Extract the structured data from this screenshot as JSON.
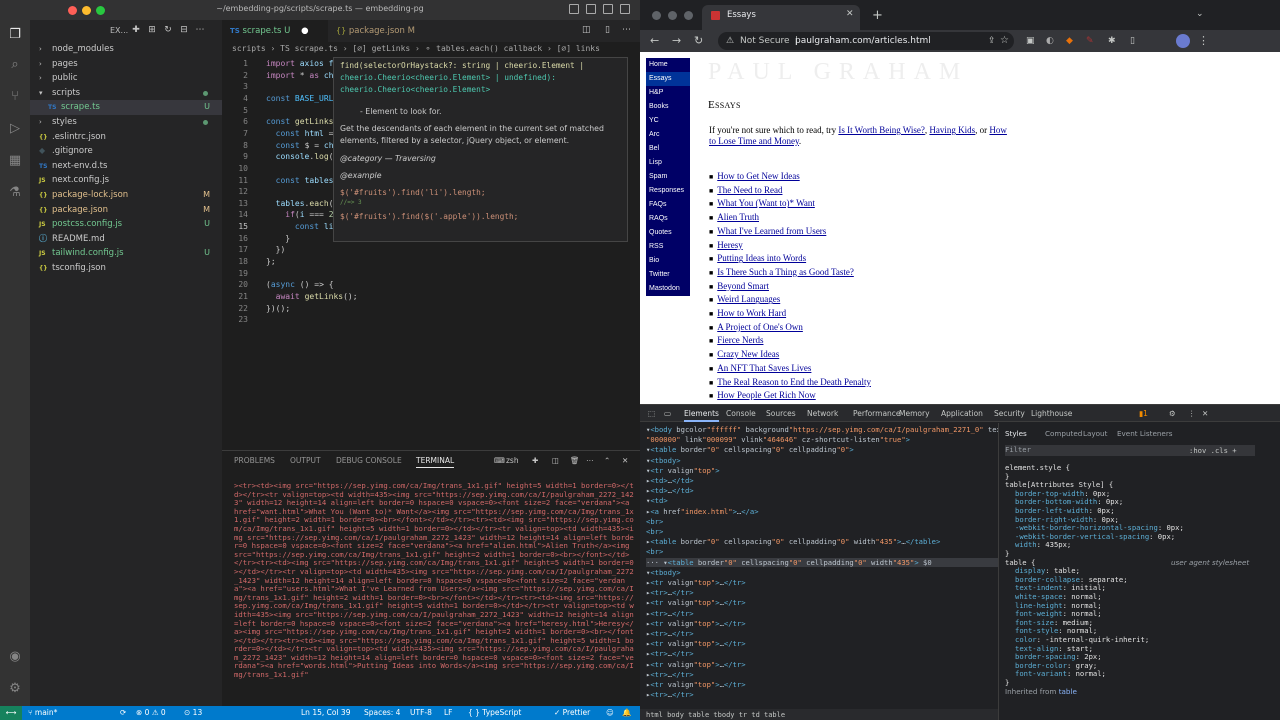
{
  "vscode": {
    "window_title": "~/embedding-pg/scripts/scrape.ts — embedding-pg",
    "explorer_label": "EX...",
    "tree": [
      {
        "name": "node_modules",
        "kind": "folder",
        "open": false,
        "indent": 1,
        "color": "#cccccc"
      },
      {
        "name": "pages",
        "kind": "folder",
        "open": false,
        "indent": 1,
        "color": "#cccccc"
      },
      {
        "name": "public",
        "kind": "folder",
        "open": false,
        "indent": 1,
        "color": "#cccccc"
      },
      {
        "name": "scripts",
        "kind": "folder",
        "open": true,
        "indent": 1,
        "color": "#cccccc"
      },
      {
        "name": "scrape.ts",
        "kind": "ts",
        "indent": 2,
        "color": "#73c991",
        "badge": "U",
        "selected": true
      },
      {
        "name": "styles",
        "kind": "folder",
        "open": false,
        "indent": 1,
        "color": "#cccccc"
      },
      {
        "name": ".eslintrc.json",
        "kind": "json",
        "indent": 1,
        "color": "#cccccc"
      },
      {
        "name": ".gitignore",
        "kind": "git",
        "indent": 1,
        "color": "#cccccc"
      },
      {
        "name": "next-env.d.ts",
        "kind": "ts",
        "indent": 1,
        "color": "#cccccc"
      },
      {
        "name": "next.config.js",
        "kind": "js",
        "indent": 1,
        "color": "#cccccc"
      },
      {
        "name": "package-lock.json",
        "kind": "json",
        "indent": 1,
        "color": "#e2c08d",
        "badge": "M"
      },
      {
        "name": "package.json",
        "kind": "json",
        "indent": 1,
        "color": "#e2c08d",
        "badge": "M"
      },
      {
        "name": "postcss.config.js",
        "kind": "js",
        "indent": 1,
        "color": "#73c991",
        "badge": "U"
      },
      {
        "name": "README.md",
        "kind": "md",
        "indent": 1,
        "color": "#cccccc"
      },
      {
        "name": "tailwind.config.js",
        "kind": "js",
        "indent": 1,
        "color": "#73c991",
        "badge": "U"
      },
      {
        "name": "tsconfig.json",
        "kind": "json",
        "indent": 1,
        "color": "#cccccc"
      }
    ],
    "tabs": [
      {
        "label": "scrape.ts",
        "badge": "U",
        "active": true
      },
      {
        "label": "package.json",
        "badge": "M",
        "active": false
      }
    ],
    "breadcrumbs": "scripts  ›  TS scrape.ts  ›  [∅] getLinks  ›  ⚬ tables.each() callback  ›  [∅] links",
    "line_numbers": [
      "1",
      "2",
      "3",
      "4",
      "5",
      "6",
      "7",
      "8",
      "9",
      "10",
      "11",
      "12",
      "13",
      "14",
      "15",
      "16",
      "17",
      "18",
      "19",
      "20",
      "21",
      "22",
      "23"
    ],
    "current_line": "15",
    "code": [
      "import axios fr",
      "import * as che",
      "",
      "const BASE_URL",
      "",
      "const getLinks",
      "  const html = ",
      "  const $ = che",
      "  console.log(h",
      "",
      "  const tables ",
      "",
      "  tables.each((",
      "    if(i === 2){",
      "      const links = $(tables).find(\"\");",
      "    }",
      "  })",
      "};",
      "",
      "(async () => {",
      "  await getLinks();",
      "})();",
      ""
    ],
    "hover": {
      "sig1": "find(selectorOrHaystack?: string | cheerio.Element |",
      "sig2": "cheerio.Cheerio<cheerio.Element> | undefined):",
      "sig3": "cheerio.Cheerio<cheerio.Element>",
      "param": "- Element to look for.",
      "desc1": "Get the descendants of each element in the current set of matched",
      "desc2": "elements, filtered by a selector, jQuery object, or element.",
      "category": "@category — Traversing",
      "example_tag": "@example",
      "ex1": "$('#fruits').find('li').length;",
      "ex1c": "//=> 3",
      "ex2": "$('#fruits').find($('.apple')).length;"
    },
    "panel_tabs": [
      "PROBLEMS",
      "OUTPUT",
      "DEBUG CONSOLE",
      "TERMINAL"
    ],
    "terminal_shell": "zsh",
    "terminal_text": "><tr><td><img src=\"https://sep.yimg.com/ca/Img/trans_1x1.gif\" height=5 width=1 border=0></td></tr><tr valign=top><td width=435><img src=\"https://sep.yimg.com/ca/I/paulgraham_2272_1423\" width=12 height=14 align=left border=0 hspace=0 vspace=0><font size=2 face=\"verdana\"><a href=\"want.html\">What You (Want to)* Want</a><img src=\"https://sep.yimg.com/ca/Img/trans_1x1.gif\" height=2 width=1 border=0><br></font></td></tr><tr><td><img src=\"https://sep.yimg.com/ca/Img/trans_1x1.gif\" height=5 width=1 border=0></td></tr><tr valign=top><td width=435><img src=\"https://sep.yimg.com/ca/I/paulgraham_2272_1423\" width=12 height=14 align=left border=0 hspace=0 vspace=0><font size=2 face=\"verdana\"><a href=\"alien.html\">Alien Truth</a><img src=\"https://sep.yimg.com/ca/Img/trans_1x1.gif\" height=2 width=1 border=0><br></font></td></tr><tr><td><img src=\"https://sep.yimg.com/ca/Img/trans_1x1.gif\" height=5 width=1 border=0></td></tr><tr valign=top><td width=435><img src=\"https://sep.yimg.com/ca/I/paulgraham_2272_1423\" width=12 height=14 align=left border=0 hspace=0 vspace=0><font size=2 face=\"verdana\"><a href=\"users.html\">What I've Learned from Users</a><img src=\"https://sep.yimg.com/ca/Img/trans_1x1.gif\" height=2 width=1 border=0><br></font></td></tr><tr><td><img src=\"https://sep.yimg.com/ca/Img/trans_1x1.gif\" height=5 width=1 border=0></td></tr><tr valign=top><td width=435><img src=\"https://sep.yimg.com/ca/I/paulgraham_2272_1423\" width=12 height=14 align=left border=0 hspace=0 vspace=0><font size=2 face=\"verdana\"><a href=\"heresy.html\">Heresy</a><img src=\"https://sep.yimg.com/ca/Img/trans_1x1.gif\" height=2 width=1 border=0><br></font></td></tr><tr><td><img src=\"https://sep.yimg.com/ca/Img/trans_1x1.gif\" height=5 width=1 border=0></td></tr><tr valign=top><td width=435><img src=\"https://sep.yimg.com/ca/I/paulgraham_2272_1423\" width=12 height=14 align=left border=0 hspace=0 vspace=0><font size=2 face=\"verdana\"><a href=\"words.html\">Putting Ideas into Words</a><img src=\"https://sep.yimg.com/ca/Img/trans_1x1.gif\"",
    "status": {
      "branch": "main*",
      "sync": "⟳",
      "errors": "⊗ 0 ⚠ 0",
      "ports": "⊙ 13",
      "position": "Ln 15, Col 39",
      "spaces": "Spaces: 4",
      "encoding": "UTF-8",
      "eol": "LF",
      "language": "{ } TypeScript",
      "prettier": "✓ Prettier"
    }
  },
  "chrome": {
    "tab_title": "Essays",
    "security": "Not Secure",
    "url": "paulgraham.com/articles.html",
    "nav": [
      "Home",
      "Essays",
      "H&P",
      "Books",
      "YC",
      "Arc",
      "Bel",
      "Lisp",
      "Spam",
      "Responses",
      "FAQs",
      "RAQs",
      "Quotes",
      "RSS",
      "Bio",
      "Twitter",
      "Mastodon"
    ],
    "selected_nav": "Essays",
    "logo": "PAUL GRAHAM",
    "heading": "Essays",
    "intro_prefix": "If you're not sure which to read, try",
    "intro_link1": "Is It Worth Being Wise?",
    "intro_link2": "Having Kids",
    "intro_mid": ", or",
    "intro_link3": "How to Lose Time and Money",
    "essays": [
      "How to Get New Ideas",
      "The Need to Read",
      "What You (Want to)* Want",
      "Alien Truth",
      "What I've Learned from Users",
      "Heresy",
      "Putting Ideas into Words",
      "Is There Such a Thing as Good Taste?",
      "Beyond Smart",
      "Weird Languages",
      "How to Work Hard",
      "A Project of One's Own",
      "Fierce Nerds",
      "Crazy New Ideas",
      "An NFT That Saves Lives",
      "The Real Reason to End the Death Penalty",
      "How People Get Rich Now"
    ],
    "devtools_tabs": [
      "Elements",
      "Console",
      "Sources",
      "Network",
      "Performance",
      "Memory",
      "Application",
      "Security",
      "Lighthouse"
    ],
    "styles_tabs": [
      "Styles",
      "Computed",
      "Layout",
      "Event Listeners"
    ],
    "filter_placeholder": "Filter",
    "filter_hint": ":hov .cls +",
    "element_style": "element.style {",
    "attr_rule_sel": "table[Attributes Style] {",
    "attr_props": [
      [
        "border-top-width",
        "0px"
      ],
      [
        "border-bottom-width",
        "0px"
      ],
      [
        "border-left-width",
        "0px"
      ],
      [
        "border-right-width",
        "0px"
      ],
      [
        "-webkit-border-horizontal-spacing",
        "0px"
      ],
      [
        "-webkit-border-vertical-spacing",
        "0px"
      ],
      [
        "width",
        "435px"
      ]
    ],
    "ua_label": "user agent stylesheet",
    "ua_props": [
      [
        "display",
        "table"
      ],
      [
        "border-collapse",
        "separate"
      ],
      [
        "text-indent",
        "initial"
      ],
      [
        "white-space",
        "normal"
      ],
      [
        "line-height",
        "normal"
      ],
      [
        "font-weight",
        "normal"
      ],
      [
        "font-size",
        "medium"
      ],
      [
        "font-style",
        "normal"
      ],
      [
        "color",
        "-internal-quirk-inherit"
      ],
      [
        "text-align",
        "start"
      ],
      [
        "border-spacing",
        "2px"
      ],
      [
        "border-color",
        "gray"
      ],
      [
        "font-variant",
        "normal"
      ]
    ],
    "inherited": "Inherited from",
    "inherited_tag": "table",
    "breadcrumbs_bottom": "html  body  table  tbody  tr  td  table",
    "dom_lines": [
      "▾<body bgcolor=\"ffffff\" background=\"https://sep.yimg.com/ca/I/paulgraham_2271_0\" text=",
      "\"000000\" link=\"000099\" vlink=\"464646\" cz-shortcut-listen=\"true\">",
      "  ▾<table border=\"0\" cellspacing=\"0\" cellpadding=\"0\">",
      "    ▾<tbody>",
      "      ▾<tr valign=\"top\">",
      "        ▸<td>…</td>",
      "        ▸<td>…</td>",
      "        ▾<td>",
      "          ▸<a href=\"index.html\">…</a>",
      "            <br>",
      "            <br>",
      "          ▸<table border=\"0\" cellspacing=\"0\" cellpadding=\"0\" width=\"435\">…</table>",
      "            <br>",
      "        ··· ▾<table border=\"0\" cellspacing=\"0\" cellpadding=\"0\" width=\"435\"> == $0",
      "            ▾<tbody>",
      "              ▸<tr valign=\"top\">…</tr>",
      "              ▸<tr>…</tr>",
      "              ▸<tr valign=\"top\">…</tr>",
      "              ▸<tr>…</tr>",
      "              ▸<tr valign=\"top\">…</tr>",
      "              ▸<tr>…</tr>",
      "              ▸<tr valign=\"top\">…</tr>",
      "              ▸<tr>…</tr>",
      "              ▸<tr valign=\"top\">…</tr>",
      "              ▸<tr>…</tr>",
      "              ▸<tr valign=\"top\">…</tr>",
      "              ▸<tr>…</tr>"
    ]
  }
}
